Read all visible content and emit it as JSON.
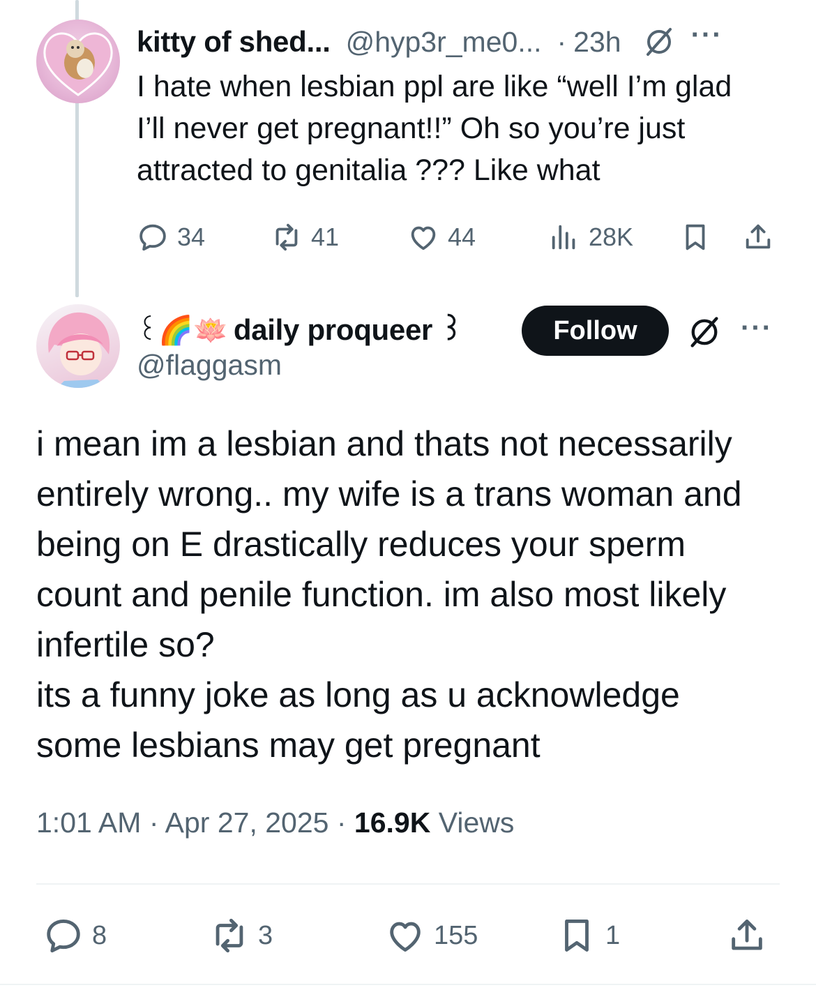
{
  "parent": {
    "name": "kitty of shed...",
    "handle": "@hyp3r_me0...",
    "separator": "·",
    "time": "23h",
    "more": "···",
    "text": "I hate when lesbian ppl are like “well I’m glad\nI’ll never get pregnant!!” Oh so you’re just\nattracted to genitalia ??? Like what",
    "stats": {
      "replies": "34",
      "reposts": "41",
      "likes": "44",
      "views": "28K"
    }
  },
  "main": {
    "name_prefix": "꒰🌈🪷",
    "name": "daily proqueer ꒱",
    "handle": "@flaggasm",
    "follow_label": "Follow",
    "more": "···",
    "text": "i mean im a lesbian and thats not necessarily\nentirely wrong.. my wife is a trans woman and\nbeing on E drastically reduces your sperm\ncount and penile function. im also most likely\ninfertile so?\nits a funny joke as long as u acknowledge\nsome lesbians may get pregnant",
    "time": "1:01 AM",
    "date": "Apr 27, 2025",
    "separator": "·",
    "views_count": "16.9K",
    "views_label": "Views",
    "stats": {
      "replies": "8",
      "reposts": "3",
      "likes": "155",
      "bookmarks": "1"
    }
  },
  "icons": [
    "reply-icon",
    "repost-icon",
    "like-icon",
    "views-icon",
    "bookmark-icon",
    "share-icon",
    "grok-icon",
    "more-icon"
  ],
  "colors": {
    "text": "#0f1419",
    "secondary": "#536471",
    "thread_line": "#cfd9de",
    "follow_bg": "#0f1419"
  }
}
